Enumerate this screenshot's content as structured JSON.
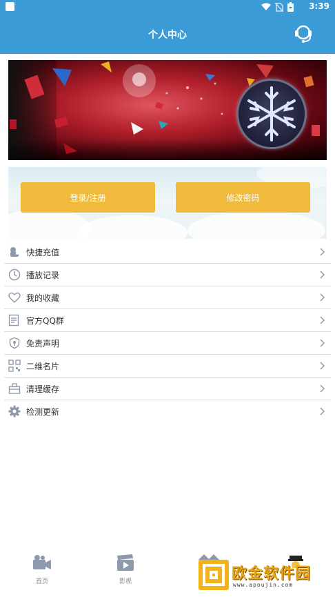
{
  "status_bar": {
    "time": "3:39"
  },
  "header": {
    "title": "个人中心"
  },
  "buttons": {
    "login": "登录/注册",
    "change_password": "修改密码"
  },
  "menu": [
    {
      "label": "快捷充值",
      "icon": "recharge-icon"
    },
    {
      "label": "播放记录",
      "icon": "history-clock-icon"
    },
    {
      "label": "我的收藏",
      "icon": "heart-icon"
    },
    {
      "label": "官方QQ群",
      "icon": "qq-group-icon"
    },
    {
      "label": "免责声明",
      "icon": "shield-icon"
    },
    {
      "label": "二维名片",
      "icon": "qr-code-icon"
    },
    {
      "label": "清理缓存",
      "icon": "clear-cache-icon"
    },
    {
      "label": "检测更新",
      "icon": "gear-icon"
    }
  ],
  "tabs": [
    {
      "label": "首页",
      "icon": "camera-icon"
    },
    {
      "label": "影视",
      "icon": "clapperboard-icon"
    }
  ],
  "watermark": {
    "text": "欧金软件园",
    "url": "www.apoujin.com"
  },
  "colors": {
    "header": "#3a9bd6",
    "button": "#f0ba3c"
  }
}
